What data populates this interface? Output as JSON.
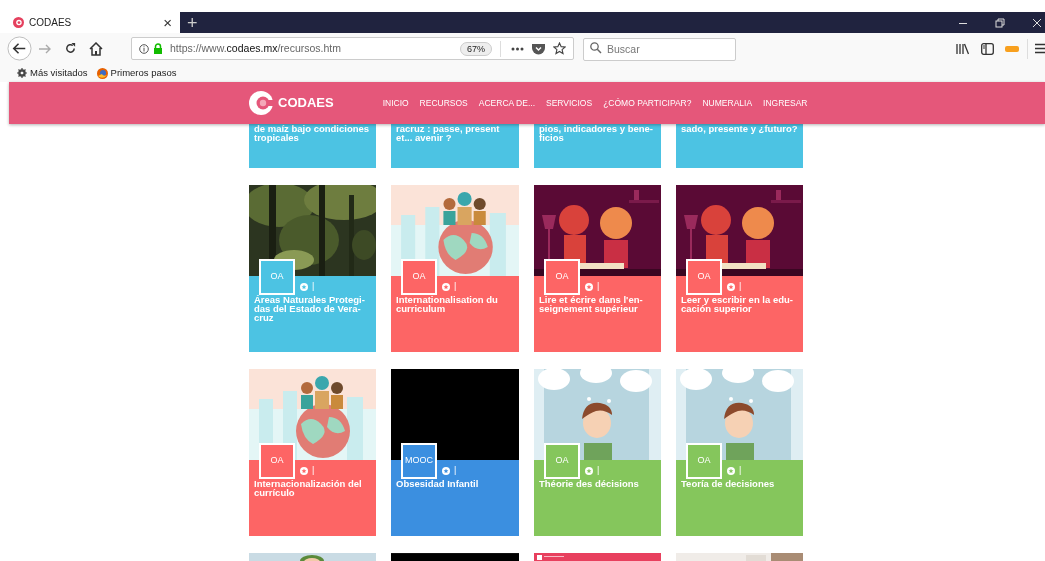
{
  "browser": {
    "tab": {
      "title": "CODAES",
      "close": "×"
    },
    "new_tab": "+",
    "url": "https://www.**codaes.mx**/recursos.htm",
    "zoom": "67%",
    "search_placeholder": "Buscar",
    "bookmarks": [
      "Más visitados",
      "Primeros pasos"
    ]
  },
  "site": {
    "logo": "CODAES",
    "nav": [
      "INICIO",
      "RECURSOS",
      "ACERCA DE...",
      "SERVICIOS",
      "¿CÓMO PARTICIPAR?",
      "NUMERALIA",
      "INGRESAR"
    ]
  },
  "cards_partial": [
    {
      "title": "de maíz bajo condiciones tropicales",
      "color": "#4cc3e3"
    },
    {
      "title": "racruz : passe, present et... avenir ?",
      "color": "#4cc3e3"
    },
    {
      "title": "pios, indicadores y bene-ficios",
      "color": "#4cc3e3"
    },
    {
      "title": "sado, presente y ¿futuro?",
      "color": "#4cc3e3"
    }
  ],
  "cards": [
    {
      "badge": "OA",
      "separator": "|",
      "title": "Áreas Naturales Protegi-das del Estado de Vera-cruz",
      "color": "#4cc3e3"
    },
    {
      "badge": "OA",
      "separator": "|",
      "title": "Internationalisation du curriculum",
      "color": "#fd6565"
    },
    {
      "badge": "OA",
      "separator": "|",
      "title": "Lire et écrire dans l'en-seignement supérieur",
      "color": "#fd6565"
    },
    {
      "badge": "OA",
      "separator": "|",
      "title": "Leer y escribir en la edu-cación superior",
      "color": "#fd6565"
    },
    {
      "badge": "OA",
      "separator": "|",
      "title": "Internacionalización del currículo",
      "color": "#fd6565"
    },
    {
      "badge": "MOOC",
      "separator": "|",
      "title": "Obsesidad Infantil",
      "color": "#3b8fe0"
    },
    {
      "badge": "OA",
      "separator": "|",
      "title": "Théorie des décisions",
      "color": "#85c65c"
    },
    {
      "badge": "OA",
      "separator": "|",
      "title": "Teoría de decisiones",
      "color": "#85c65c"
    }
  ]
}
